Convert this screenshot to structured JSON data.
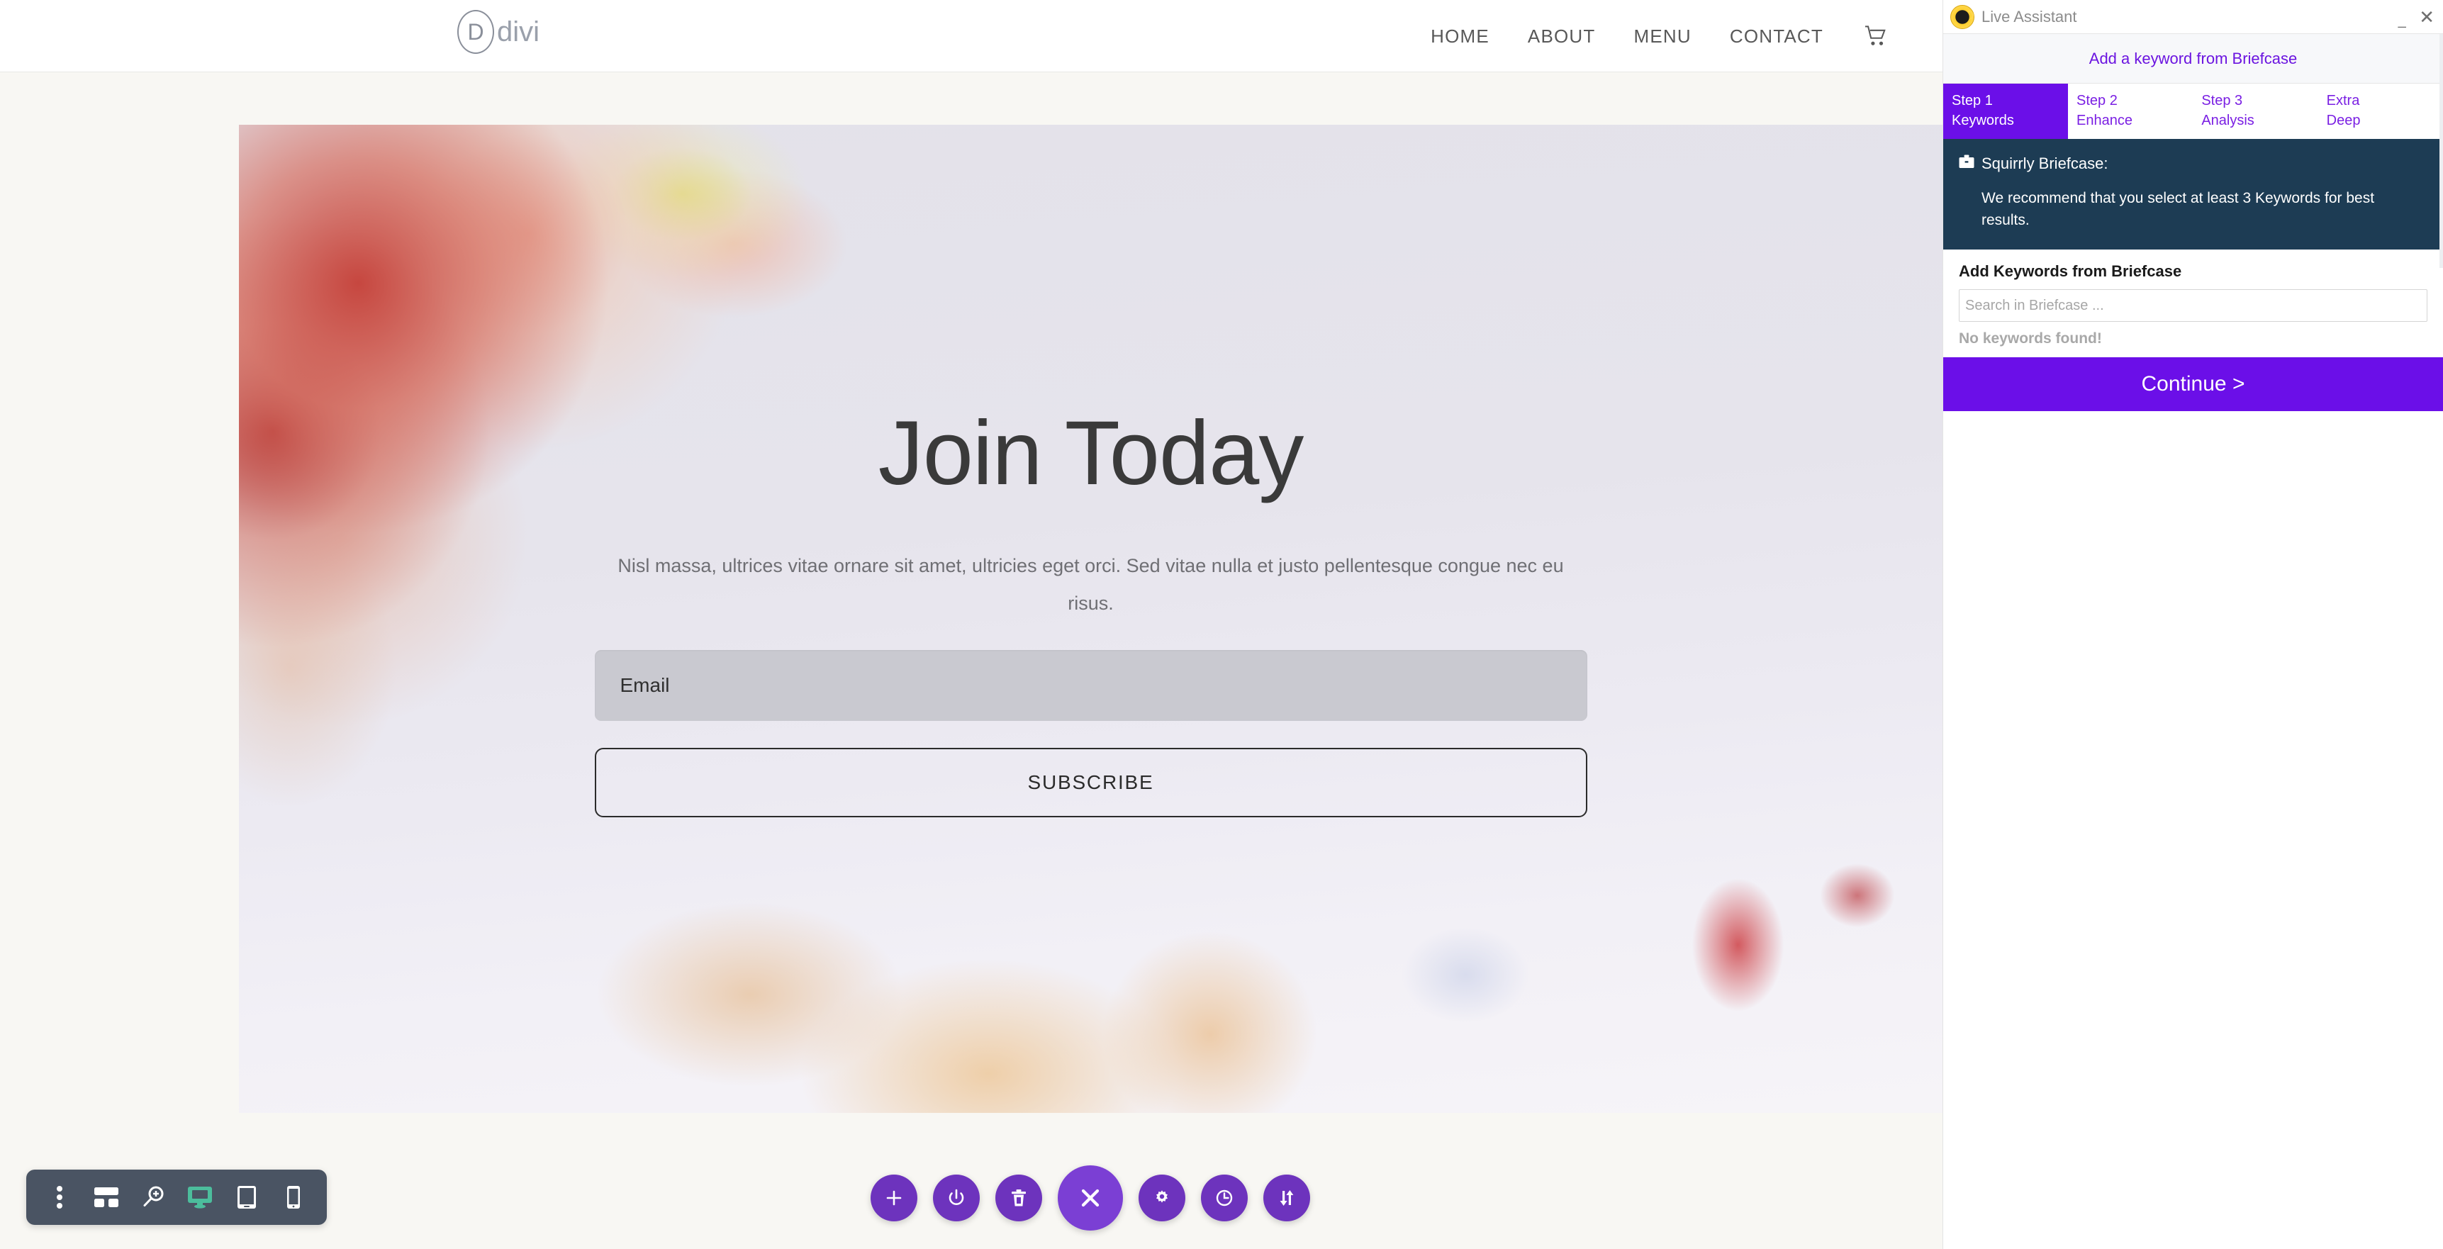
{
  "site": {
    "logo": {
      "mark": "D",
      "word": "divi",
      "icon": "divi-logo-icon"
    },
    "nav": [
      {
        "label": "HOME",
        "name": "nav-home"
      },
      {
        "label": "ABOUT",
        "name": "nav-about"
      },
      {
        "label": "MENU",
        "name": "nav-menu"
      },
      {
        "label": "CONTACT",
        "name": "nav-contact"
      }
    ],
    "cart_icon": "shopping-cart-icon",
    "hero": {
      "title": "Join Today",
      "subtitle": "Nisl massa, ultrices vitae ornare sit amet, ultricies eget orci. Sed vitae nulla et justo pellentesque congue nec eu risus.",
      "email_placeholder": "Email",
      "email_value": "",
      "subscribe_label": "SUBSCRIBE"
    }
  },
  "builder": {
    "left_tools": [
      {
        "name": "more-options-icon",
        "title": "More options"
      },
      {
        "name": "wireframe-view-icon",
        "title": "Wireframe view"
      },
      {
        "name": "zoom-out-icon",
        "title": "Zoom"
      },
      {
        "name": "desktop-view-icon",
        "title": "Desktop view",
        "active": true
      },
      {
        "name": "tablet-view-icon",
        "title": "Tablet view"
      },
      {
        "name": "phone-view-icon",
        "title": "Phone view"
      }
    ],
    "center_tools": [
      {
        "name": "add-section-icon",
        "title": "Add section"
      },
      {
        "name": "power-toggle-icon",
        "title": "Enable / disable"
      },
      {
        "name": "delete-icon",
        "title": "Delete"
      },
      {
        "name": "close-builder-icon",
        "title": "Close",
        "primary": true
      },
      {
        "name": "settings-gear-icon",
        "title": "Settings"
      },
      {
        "name": "history-clock-icon",
        "title": "Editing history"
      },
      {
        "name": "sort-arrows-icon",
        "title": "Portability"
      }
    ]
  },
  "live_assistant": {
    "title": "Live Assistant",
    "logo_icon": "squirrly-logo-icon",
    "minimize_glyph": "_",
    "close_glyph": "✕",
    "briefcase_link": "Add a keyword from Briefcase",
    "tabs": [
      {
        "line1": "Step 1",
        "line2": "Keywords",
        "active": true
      },
      {
        "line1": "Step 2",
        "line2": "Enhance",
        "active": false
      },
      {
        "line1": "Step 3",
        "line2": "Analysis",
        "active": false
      },
      {
        "line1": "Extra",
        "line2": "Deep",
        "active": false
      }
    ],
    "info": {
      "icon": "briefcase-icon",
      "heading": "Squirrly Briefcase:",
      "text": "We recommend that you select at least 3 Keywords for best results."
    },
    "section_title": "Add Keywords from Briefcase",
    "search_placeholder": "Search in Briefcase ...",
    "search_value": "",
    "no_results": "No keywords found!",
    "continue_label": "Continue >"
  },
  "colors": {
    "accent_purple": "#6b0fe8",
    "builder_purple": "#6d33bd",
    "info_navy": "#1d3c54",
    "builder_bar": "#4a5463",
    "active_green": "#4cbd9c"
  }
}
